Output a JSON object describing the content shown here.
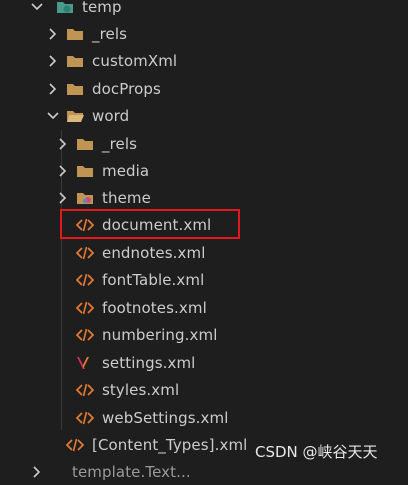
{
  "explorer": {
    "items": [
      {
        "label": "temp",
        "icon": "folder-open-icon"
      },
      {
        "label": "_rels",
        "icon": "folder-icon"
      },
      {
        "label": "customXml",
        "icon": "folder-icon"
      },
      {
        "label": "docProps",
        "icon": "folder-icon"
      },
      {
        "label": "word",
        "icon": "folder-open-icon"
      },
      {
        "label": "_rels",
        "icon": "folder-icon"
      },
      {
        "label": "media",
        "icon": "folder-icon"
      },
      {
        "label": "theme",
        "icon": "theme-folder-icon"
      },
      {
        "label": "document.xml",
        "icon": "xml-file-icon"
      },
      {
        "label": "endnotes.xml",
        "icon": "xml-file-icon"
      },
      {
        "label": "fontTable.xml",
        "icon": "xml-file-icon"
      },
      {
        "label": "footnotes.xml",
        "icon": "xml-file-icon"
      },
      {
        "label": "numbering.xml",
        "icon": "xml-file-icon"
      },
      {
        "label": "settings.xml",
        "icon": "settings-xml-icon"
      },
      {
        "label": "styles.xml",
        "icon": "xml-file-icon"
      },
      {
        "label": "webSettings.xml",
        "icon": "xml-file-icon"
      },
      {
        "label": "[Content_Types].xml",
        "icon": "xml-file-icon"
      },
      {
        "label": "template.Text...",
        "icon": "chevron-right-icon"
      }
    ]
  },
  "highlighted_item": "document.xml",
  "colors": {
    "background": "#1e1e1e",
    "folder": "#c09553",
    "xml": "#e37933",
    "highlight": "#e0191a",
    "text": "#cccccc"
  },
  "watermark": "CSDN @峡谷天天"
}
